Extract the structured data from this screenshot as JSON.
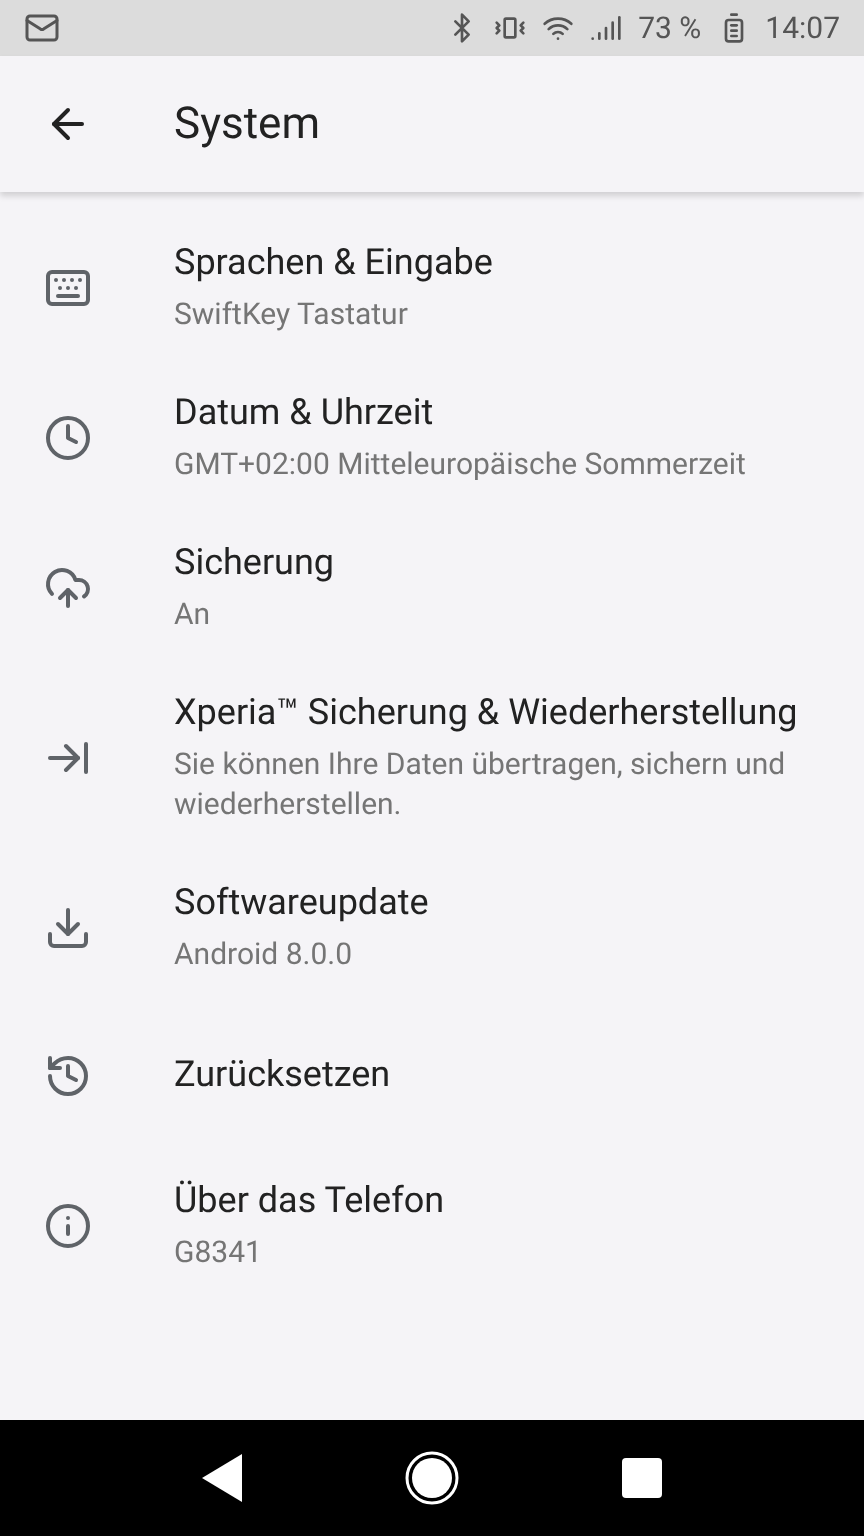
{
  "status_bar": {
    "battery": "73 %",
    "time": "14:07"
  },
  "app_bar": {
    "title": "System"
  },
  "items": [
    {
      "kind": "keyboard",
      "title": "Sprachen & Eingabe",
      "summary": "SwiftKey Tastatur"
    },
    {
      "kind": "clock",
      "title": "Datum & Uhrzeit",
      "summary": "GMT+02:00 Mitteleuropäische Sommerzeit"
    },
    {
      "kind": "cloud",
      "title": "Sicherung",
      "summary": "An"
    },
    {
      "kind": "transfer",
      "title": "Xperia™ Sicherung & Wiederherstellung",
      "summary": "Sie können Ihre Daten übertragen, sichern und wiederherstellen."
    },
    {
      "kind": "update",
      "title": "Softwareupdate",
      "summary": "Android 8.0.0"
    },
    {
      "kind": "reset",
      "title": "Zurücksetzen"
    },
    {
      "kind": "info",
      "title": "Über das Telefon",
      "summary": "G8341"
    }
  ]
}
